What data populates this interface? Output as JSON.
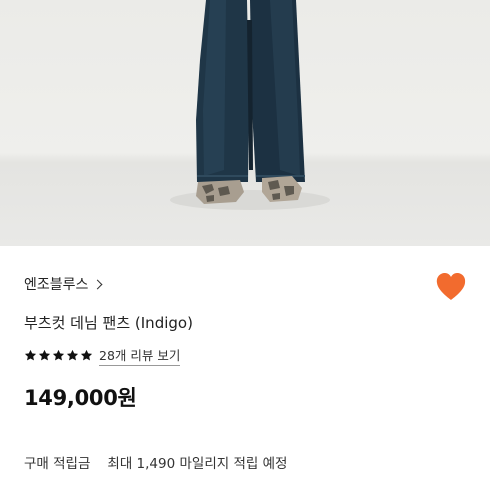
{
  "product": {
    "brand": "엔조블루스",
    "title": "부츠컷 데님 팬츠 (Indigo)",
    "rating_stars": 5,
    "review_link": "28개 리뷰 보기",
    "price": "149,000원",
    "points_label": "구매 적립금",
    "points_value": "최대 1,490 마일리지 적립 예정"
  },
  "icons": {
    "brand_chevron": "chevron-right-icon",
    "favorite": "heart-icon",
    "rating": "star-icon"
  },
  "colors": {
    "heart": "#f26b2e",
    "star": "#111111",
    "text": "#222222"
  }
}
